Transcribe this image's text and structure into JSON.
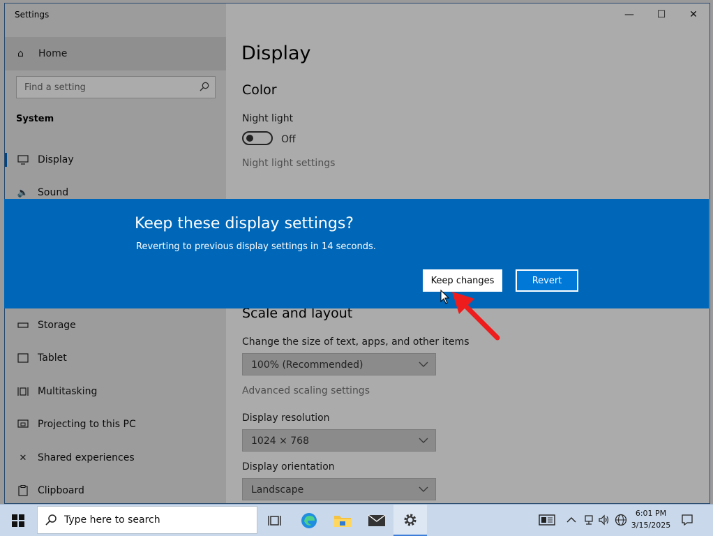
{
  "window": {
    "title": "Settings",
    "controls": {
      "minimize": "—",
      "maximize": "☐",
      "close": "✕"
    }
  },
  "sidebar": {
    "home_label": "Home",
    "search_placeholder": "Find a setting",
    "section_heading": "System",
    "items": [
      {
        "label": "Display",
        "icon": "monitor-icon",
        "active": true
      },
      {
        "label": "Sound",
        "icon": "speaker-icon"
      },
      {
        "label": "Storage",
        "icon": "storage-icon"
      },
      {
        "label": "Tablet",
        "icon": "tablet-icon"
      },
      {
        "label": "Multitasking",
        "icon": "multitasking-icon"
      },
      {
        "label": "Projecting to this PC",
        "icon": "projector-icon"
      },
      {
        "label": "Shared experiences",
        "icon": "shared-icon"
      },
      {
        "label": "Clipboard",
        "icon": "clipboard-icon"
      }
    ]
  },
  "main": {
    "page_title": "Display",
    "color_heading": "Color",
    "night_light_label": "Night light",
    "night_light_state": "Off",
    "night_light_settings_link": "Night light settings",
    "scale_heading": "Scale and layout",
    "scale_label": "Change the size of text, apps, and other items",
    "scale_value": "100% (Recommended)",
    "advanced_scaling_link": "Advanced scaling settings",
    "resolution_label": "Display resolution",
    "resolution_value": "1024 × 768",
    "orientation_label": "Display orientation",
    "orientation_value": "Landscape"
  },
  "dialog": {
    "heading": "Keep these display settings?",
    "message": "Reverting to previous display settings in 14 seconds.",
    "keep_label": "Keep changes",
    "revert_label": "Revert"
  },
  "taskbar": {
    "search_placeholder": "Type here to search",
    "time": "6:01 PM",
    "date": "3/15/2025"
  },
  "colors": {
    "dialog_bg": "#0067b8",
    "accent": "#0078d7",
    "annotation_arrow": "#ee1c1c"
  }
}
